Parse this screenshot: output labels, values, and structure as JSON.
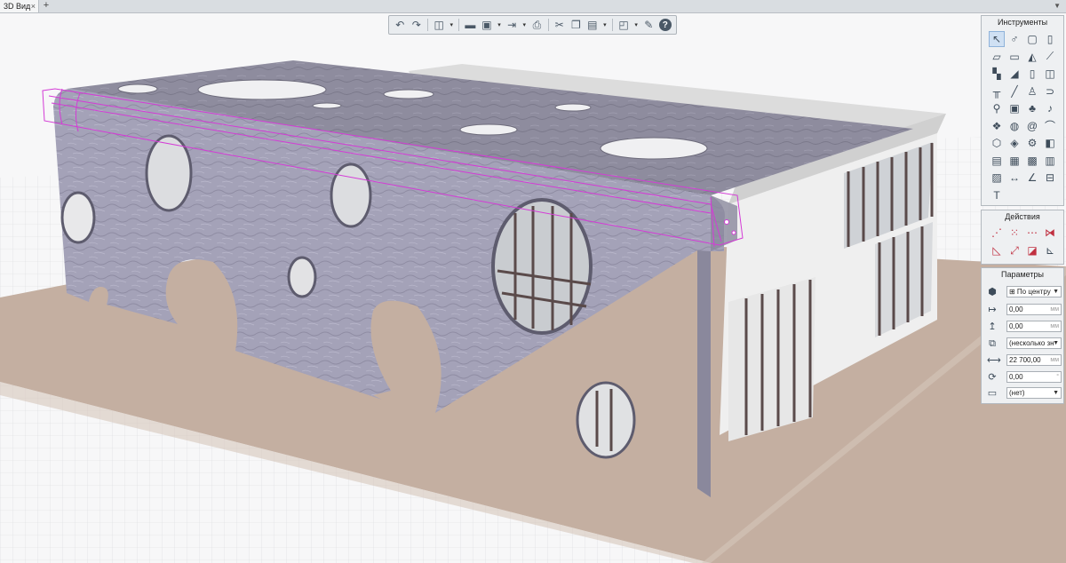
{
  "tabs": [
    {
      "label": "3D Вид",
      "close": "×"
    }
  ],
  "tab_add": "+",
  "tab_menu": "▼",
  "toolbar": {
    "buttons": [
      {
        "icon": "undo-icon",
        "glyph": "↶"
      },
      {
        "icon": "redo-icon",
        "glyph": "↷"
      },
      {
        "icon": "cube-view-icon",
        "glyph": "◫"
      },
      {
        "icon": "dropdown-arrow-icon",
        "glyph": "▾"
      },
      {
        "icon": "open-folder-icon",
        "glyph": "▬"
      },
      {
        "icon": "save-icon",
        "glyph": "▣"
      },
      {
        "icon": "dropdown-arrow-icon",
        "glyph": "▾"
      },
      {
        "icon": "export-icon",
        "glyph": "⇥"
      },
      {
        "icon": "dropdown-arrow-icon",
        "glyph": "▾"
      },
      {
        "icon": "print-icon",
        "glyph": "⎙"
      },
      {
        "icon": "cut-icon",
        "glyph": "✂"
      },
      {
        "icon": "copy-icon",
        "glyph": "❐"
      },
      {
        "icon": "paste-icon",
        "glyph": "▤"
      },
      {
        "icon": "dropdown-arrow-icon",
        "glyph": "▾"
      },
      {
        "icon": "layers-icon",
        "glyph": "◰"
      },
      {
        "icon": "dropdown-arrow-icon",
        "glyph": "▾"
      },
      {
        "icon": "wrench-icon",
        "glyph": "✎"
      },
      {
        "icon": "help-icon",
        "glyph": "?"
      }
    ]
  },
  "tools_panel": {
    "title": "Инструменты",
    "items": [
      {
        "icon": "select-arrow-icon",
        "glyph": "↖",
        "selected": true
      },
      {
        "icon": "magic-wand-icon",
        "glyph": "♂"
      },
      {
        "icon": "wall-icon",
        "glyph": "▢"
      },
      {
        "icon": "column-icon",
        "glyph": "▯"
      },
      {
        "icon": "slab-icon",
        "glyph": "▱"
      },
      {
        "icon": "floor-icon",
        "glyph": "▭"
      },
      {
        "icon": "roof-icon",
        "glyph": "◭"
      },
      {
        "icon": "beam-icon",
        "glyph": "⟋"
      },
      {
        "icon": "stairs-icon",
        "glyph": "▚"
      },
      {
        "icon": "ramp-icon",
        "glyph": "◢"
      },
      {
        "icon": "door-icon",
        "glyph": "▯"
      },
      {
        "icon": "window-icon",
        "glyph": "◫"
      },
      {
        "icon": "railing-icon",
        "glyph": "╥"
      },
      {
        "icon": "line-icon",
        "glyph": "╱"
      },
      {
        "icon": "lamp-icon",
        "glyph": "♙"
      },
      {
        "icon": "pipe-icon",
        "glyph": "⊃"
      },
      {
        "icon": "plumbing-icon",
        "glyph": "⚲"
      },
      {
        "icon": "furniture-icon",
        "glyph": "▣"
      },
      {
        "icon": "tree-icon",
        "glyph": "♣"
      },
      {
        "icon": "sound-icon",
        "glyph": "♪"
      },
      {
        "icon": "object-icon",
        "glyph": "❖"
      },
      {
        "icon": "symbol-icon",
        "glyph": "◍"
      },
      {
        "icon": "spiral-icon",
        "glyph": "@"
      },
      {
        "icon": "curve-icon",
        "glyph": "⌒"
      },
      {
        "icon": "zone-icon",
        "glyph": "⬡"
      },
      {
        "icon": "morph-icon",
        "glyph": "◈"
      },
      {
        "icon": "gear-icon",
        "glyph": "⚙"
      },
      {
        "icon": "shell-icon",
        "glyph": "◧"
      },
      {
        "icon": "cabinet-icon",
        "glyph": "▤"
      },
      {
        "icon": "table-icon",
        "glyph": "▦"
      },
      {
        "icon": "label-icon",
        "glyph": "▩"
      },
      {
        "icon": "section-icon",
        "glyph": "▥"
      },
      {
        "icon": "image-icon",
        "glyph": "▨"
      },
      {
        "icon": "dimension-icon",
        "glyph": "↔"
      },
      {
        "icon": "angle-icon",
        "glyph": "∠"
      },
      {
        "icon": "level-icon",
        "glyph": "⊟"
      },
      {
        "icon": "text-icon",
        "glyph": "T"
      }
    ]
  },
  "actions_panel": {
    "title": "Действия",
    "items": [
      {
        "icon": "move-dots-icon",
        "glyph": "⋰",
        "color": "#c03040"
      },
      {
        "icon": "distribute-icon",
        "glyph": "⁙",
        "color": "#c03040"
      },
      {
        "icon": "array-icon",
        "glyph": "⋯",
        "color": "#c03040"
      },
      {
        "icon": "mirror-icon",
        "glyph": "⧒",
        "color": "#c03040"
      },
      {
        "icon": "rotate-icon",
        "glyph": "◺",
        "color": "#c03040"
      },
      {
        "icon": "stretch-icon",
        "glyph": "⤢",
        "color": "#c03040"
      },
      {
        "icon": "offset-icon",
        "glyph": "◪",
        "color": "#c03040"
      },
      {
        "icon": "align-icon",
        "glyph": "⊾",
        "color": "#3e4c5a"
      }
    ]
  },
  "params_panel": {
    "title": "Параметры",
    "rows": [
      {
        "icon": "anchor-cube-icon",
        "glyph": "⬢",
        "value": "⊞ По центру",
        "unit": "",
        "dropdown": true
      },
      {
        "icon": "offset-x-icon",
        "glyph": "↦",
        "value": "0,00",
        "unit": "мм",
        "dropdown": false
      },
      {
        "icon": "offset-y-icon",
        "glyph": "↥",
        "value": "0,00",
        "unit": "мм",
        "dropdown": false
      },
      {
        "icon": "layer-copy-icon",
        "glyph": "⧉",
        "value": "(несколько зн",
        "unit": "",
        "dropdown": true
      },
      {
        "icon": "length-icon",
        "glyph": "⟷",
        "value": "22 700,00",
        "unit": "мм",
        "dropdown": false
      },
      {
        "icon": "angle-rotate-icon",
        "glyph": "⟳",
        "value": "0,00",
        "unit": "°",
        "dropdown": false
      },
      {
        "icon": "tag-icon",
        "glyph": "▭",
        "value": "(нет)",
        "unit": "",
        "dropdown": true
      }
    ]
  },
  "colors": {
    "ground": "#c4afa1",
    "ground_edge": "#d6c6ba",
    "grid_bg": "#f7f7f8",
    "wall_front": "#a19fb6",
    "wall_top": "#8d8b9c",
    "selection": "#d43bd6",
    "building_light": "#eeeeee",
    "glass": "#c9ccd0",
    "mullion": "#5a4a4a"
  }
}
